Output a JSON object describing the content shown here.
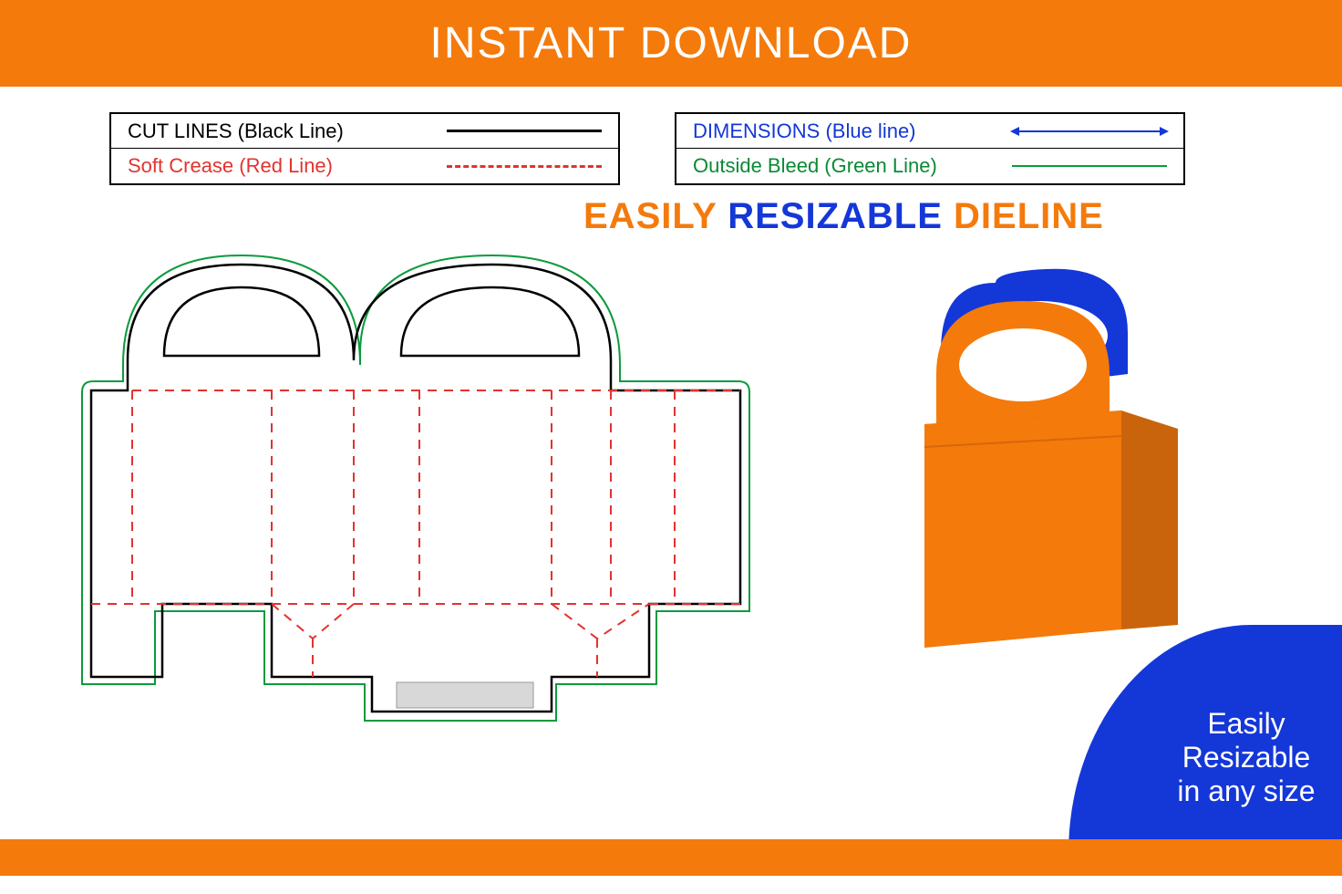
{
  "banner_title": "INSTANT DOWNLOAD",
  "legend_left": {
    "row1_label": "CUT LINES (Black Line)",
    "row2_label": "Soft Crease (Red Line)"
  },
  "legend_right": {
    "row1_label": "DIMENSIONS (Blue line)",
    "row2_label": "Outside Bleed (Green Line)"
  },
  "headline": {
    "word1": "EASILY",
    "word2": "RESIZABLE",
    "word3": "DIELINE"
  },
  "badge": {
    "line1": "Easily",
    "line2": "Resizable",
    "line3": "in any size"
  },
  "colors": {
    "orange": "#f47a0b",
    "blue": "#1437d8",
    "red": "#e2332f",
    "green": "#0a9b3c",
    "black": "#000000"
  },
  "dieline": {
    "description": "Unfolded handle-box template with cut lines (black), fold/crease lines (red dashed), and bleed outline (green).",
    "line_types": [
      "cut",
      "crease",
      "bleed",
      "dimension"
    ]
  },
  "mockup": {
    "description": "3D rendered box with orange body and blue handle on orange handle, showing assembled product."
  }
}
